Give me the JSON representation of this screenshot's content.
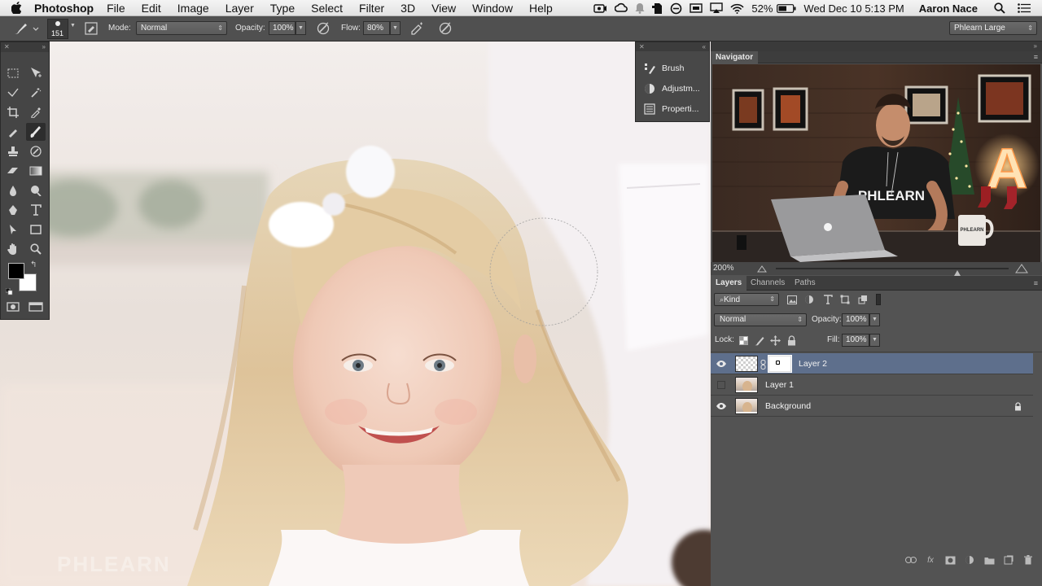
{
  "menubar": {
    "app_name": "Photoshop",
    "menus": [
      "File",
      "Edit",
      "Image",
      "Layer",
      "Type",
      "Select",
      "Filter",
      "3D",
      "View",
      "Window",
      "Help"
    ],
    "battery": "52%",
    "clock": "Wed Dec 10  5:13 PM",
    "user": "Aaron Nace"
  },
  "options_bar": {
    "brush_size": "151",
    "mode_label": "Mode:",
    "mode_value": "Normal",
    "opacity_label": "Opacity:",
    "opacity_value": "100%",
    "flow_label": "Flow:",
    "flow_value": "80%",
    "workspace": "Phlearn Large"
  },
  "mini_dock": {
    "items": [
      {
        "label": "Brush",
        "icon": "brush-preset-icon"
      },
      {
        "label": "Adjustm...",
        "icon": "adjustments-icon"
      },
      {
        "label": "Properti...",
        "icon": "properties-icon"
      }
    ]
  },
  "navigator": {
    "tab": "Navigator",
    "zoom": "200%",
    "zoom_slider": 0.78,
    "thumbnail": {
      "shirt_text": "PHLEARN",
      "sign_letter": "A",
      "mug_text": "PHLEARN"
    }
  },
  "layers_panel": {
    "tabs": [
      "Layers",
      "Channels",
      "Paths"
    ],
    "filter_kind": "Kind",
    "blend_mode": "Normal",
    "opacity_label": "Opacity:",
    "opacity_value": "100%",
    "lock_label": "Lock:",
    "fill_label": "Fill:",
    "fill_value": "100%",
    "layers": [
      {
        "name": "Layer 2",
        "visible": true,
        "selected": true,
        "has_mask": true,
        "locked": false
      },
      {
        "name": "Layer 1",
        "visible": false,
        "selected": false,
        "has_mask": false,
        "locked": false
      },
      {
        "name": "Background",
        "visible": true,
        "selected": false,
        "has_mask": false,
        "locked": true
      }
    ]
  },
  "canvas": {
    "watermark": "PHLEARN"
  },
  "colors": {
    "selection": "#5e6f8c",
    "panel": "#535353",
    "foreground_swatch": "#000000",
    "background_swatch": "#ffffff"
  }
}
